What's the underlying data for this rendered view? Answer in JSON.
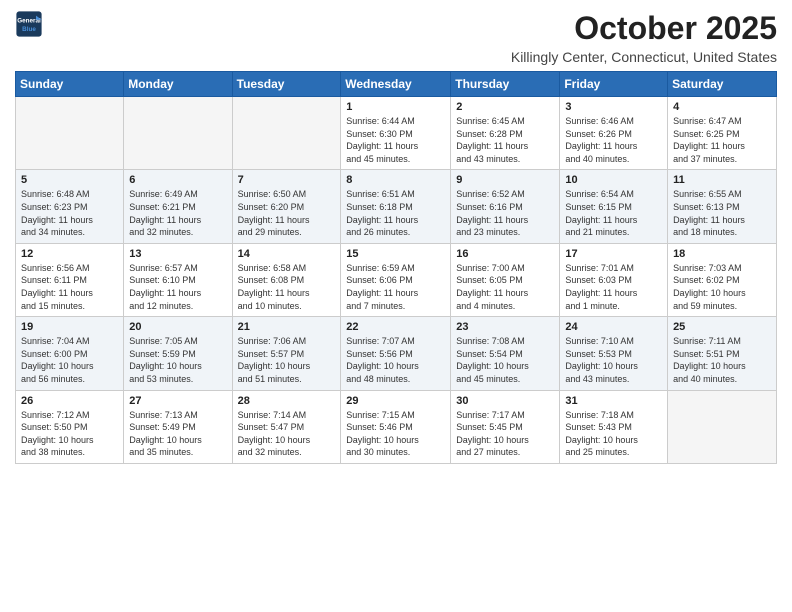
{
  "header": {
    "logo_line1": "General",
    "logo_line2": "Blue",
    "month": "October 2025",
    "location": "Killingly Center, Connecticut, United States"
  },
  "weekdays": [
    "Sunday",
    "Monday",
    "Tuesday",
    "Wednesday",
    "Thursday",
    "Friday",
    "Saturday"
  ],
  "weeks": [
    [
      {
        "day": "",
        "info": ""
      },
      {
        "day": "",
        "info": ""
      },
      {
        "day": "",
        "info": ""
      },
      {
        "day": "1",
        "info": "Sunrise: 6:44 AM\nSunset: 6:30 PM\nDaylight: 11 hours\nand 45 minutes."
      },
      {
        "day": "2",
        "info": "Sunrise: 6:45 AM\nSunset: 6:28 PM\nDaylight: 11 hours\nand 43 minutes."
      },
      {
        "day": "3",
        "info": "Sunrise: 6:46 AM\nSunset: 6:26 PM\nDaylight: 11 hours\nand 40 minutes."
      },
      {
        "day": "4",
        "info": "Sunrise: 6:47 AM\nSunset: 6:25 PM\nDaylight: 11 hours\nand 37 minutes."
      }
    ],
    [
      {
        "day": "5",
        "info": "Sunrise: 6:48 AM\nSunset: 6:23 PM\nDaylight: 11 hours\nand 34 minutes."
      },
      {
        "day": "6",
        "info": "Sunrise: 6:49 AM\nSunset: 6:21 PM\nDaylight: 11 hours\nand 32 minutes."
      },
      {
        "day": "7",
        "info": "Sunrise: 6:50 AM\nSunset: 6:20 PM\nDaylight: 11 hours\nand 29 minutes."
      },
      {
        "day": "8",
        "info": "Sunrise: 6:51 AM\nSunset: 6:18 PM\nDaylight: 11 hours\nand 26 minutes."
      },
      {
        "day": "9",
        "info": "Sunrise: 6:52 AM\nSunset: 6:16 PM\nDaylight: 11 hours\nand 23 minutes."
      },
      {
        "day": "10",
        "info": "Sunrise: 6:54 AM\nSunset: 6:15 PM\nDaylight: 11 hours\nand 21 minutes."
      },
      {
        "day": "11",
        "info": "Sunrise: 6:55 AM\nSunset: 6:13 PM\nDaylight: 11 hours\nand 18 minutes."
      }
    ],
    [
      {
        "day": "12",
        "info": "Sunrise: 6:56 AM\nSunset: 6:11 PM\nDaylight: 11 hours\nand 15 minutes."
      },
      {
        "day": "13",
        "info": "Sunrise: 6:57 AM\nSunset: 6:10 PM\nDaylight: 11 hours\nand 12 minutes."
      },
      {
        "day": "14",
        "info": "Sunrise: 6:58 AM\nSunset: 6:08 PM\nDaylight: 11 hours\nand 10 minutes."
      },
      {
        "day": "15",
        "info": "Sunrise: 6:59 AM\nSunset: 6:06 PM\nDaylight: 11 hours\nand 7 minutes."
      },
      {
        "day": "16",
        "info": "Sunrise: 7:00 AM\nSunset: 6:05 PM\nDaylight: 11 hours\nand 4 minutes."
      },
      {
        "day": "17",
        "info": "Sunrise: 7:01 AM\nSunset: 6:03 PM\nDaylight: 11 hours\nand 1 minute."
      },
      {
        "day": "18",
        "info": "Sunrise: 7:03 AM\nSunset: 6:02 PM\nDaylight: 10 hours\nand 59 minutes."
      }
    ],
    [
      {
        "day": "19",
        "info": "Sunrise: 7:04 AM\nSunset: 6:00 PM\nDaylight: 10 hours\nand 56 minutes."
      },
      {
        "day": "20",
        "info": "Sunrise: 7:05 AM\nSunset: 5:59 PM\nDaylight: 10 hours\nand 53 minutes."
      },
      {
        "day": "21",
        "info": "Sunrise: 7:06 AM\nSunset: 5:57 PM\nDaylight: 10 hours\nand 51 minutes."
      },
      {
        "day": "22",
        "info": "Sunrise: 7:07 AM\nSunset: 5:56 PM\nDaylight: 10 hours\nand 48 minutes."
      },
      {
        "day": "23",
        "info": "Sunrise: 7:08 AM\nSunset: 5:54 PM\nDaylight: 10 hours\nand 45 minutes."
      },
      {
        "day": "24",
        "info": "Sunrise: 7:10 AM\nSunset: 5:53 PM\nDaylight: 10 hours\nand 43 minutes."
      },
      {
        "day": "25",
        "info": "Sunrise: 7:11 AM\nSunset: 5:51 PM\nDaylight: 10 hours\nand 40 minutes."
      }
    ],
    [
      {
        "day": "26",
        "info": "Sunrise: 7:12 AM\nSunset: 5:50 PM\nDaylight: 10 hours\nand 38 minutes."
      },
      {
        "day": "27",
        "info": "Sunrise: 7:13 AM\nSunset: 5:49 PM\nDaylight: 10 hours\nand 35 minutes."
      },
      {
        "day": "28",
        "info": "Sunrise: 7:14 AM\nSunset: 5:47 PM\nDaylight: 10 hours\nand 32 minutes."
      },
      {
        "day": "29",
        "info": "Sunrise: 7:15 AM\nSunset: 5:46 PM\nDaylight: 10 hours\nand 30 minutes."
      },
      {
        "day": "30",
        "info": "Sunrise: 7:17 AM\nSunset: 5:45 PM\nDaylight: 10 hours\nand 27 minutes."
      },
      {
        "day": "31",
        "info": "Sunrise: 7:18 AM\nSunset: 5:43 PM\nDaylight: 10 hours\nand 25 minutes."
      },
      {
        "day": "",
        "info": ""
      }
    ]
  ]
}
